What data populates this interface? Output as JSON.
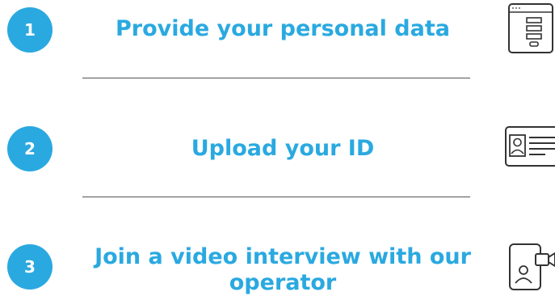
{
  "colors": {
    "accent": "#2aa9e0",
    "badge_text": "#ffffff",
    "divider": "#555555",
    "icon_stroke": "#333333"
  },
  "steps": [
    {
      "number": "1",
      "title": "Provide your personal data",
      "icon": "form-document-icon"
    },
    {
      "number": "2",
      "title": "Upload your ID",
      "icon": "id-card-icon"
    },
    {
      "number": "3",
      "title": "Join a video interview with our operator",
      "icon": "video-call-icon"
    }
  ]
}
